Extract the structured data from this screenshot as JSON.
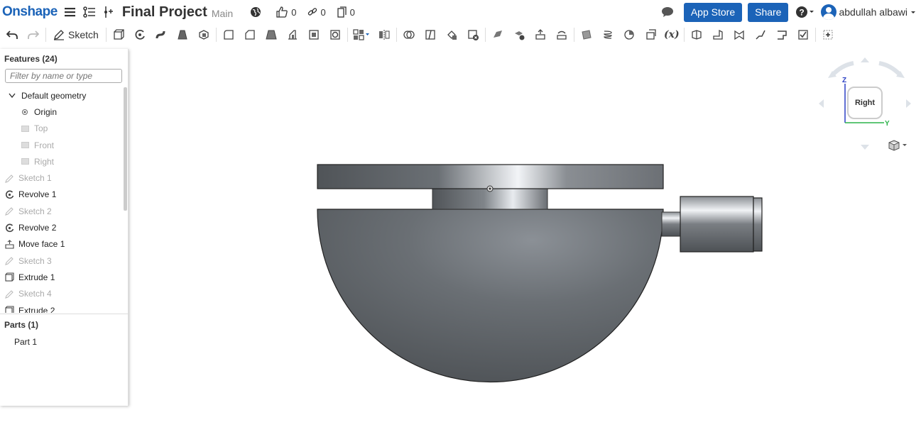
{
  "header": {
    "logo": "Onshape",
    "doc_title": "Final Project",
    "branch": "Main",
    "likes": "0",
    "links": "0",
    "copies": "0",
    "app_store": "App Store",
    "share": "Share",
    "user_name": "abdullah albawi"
  },
  "toolbar": {
    "sketch_label": "Sketch",
    "variable_label": "(x)"
  },
  "features": {
    "title": "Features (24)",
    "filter_placeholder": "Filter by name or type",
    "items": [
      {
        "label": "Default geometry",
        "icon": "chevron-down-icon"
      },
      {
        "label": "Origin",
        "icon": "origin-icon"
      },
      {
        "label": "Top",
        "icon": "plane-icon"
      },
      {
        "label": "Front",
        "icon": "plane-icon"
      },
      {
        "label": "Right",
        "icon": "plane-icon"
      },
      {
        "label": "Sketch 1",
        "icon": "sketch-icon"
      },
      {
        "label": "Revolve 1",
        "icon": "revolve-icon"
      },
      {
        "label": "Sketch 2",
        "icon": "sketch-icon"
      },
      {
        "label": "Revolve 2",
        "icon": "revolve-icon"
      },
      {
        "label": "Move face 1",
        "icon": "move-face-icon"
      },
      {
        "label": "Sketch 3",
        "icon": "sketch-icon"
      },
      {
        "label": "Extrude 1",
        "icon": "extrude-icon"
      },
      {
        "label": "Sketch 4",
        "icon": "sketch-icon"
      },
      {
        "label": "Extrude 2",
        "icon": "extrude-icon"
      }
    ]
  },
  "parts": {
    "title": "Parts (1)",
    "items": [
      {
        "label": "Part 1"
      }
    ]
  },
  "navcube": {
    "face": "Right",
    "axis_z": "Z",
    "axis_y": "Y"
  },
  "colors": {
    "accent": "#1b63b8",
    "part": "#5f6469",
    "axis_z": "#2a3fc4",
    "axis_y": "#2bb34a"
  }
}
